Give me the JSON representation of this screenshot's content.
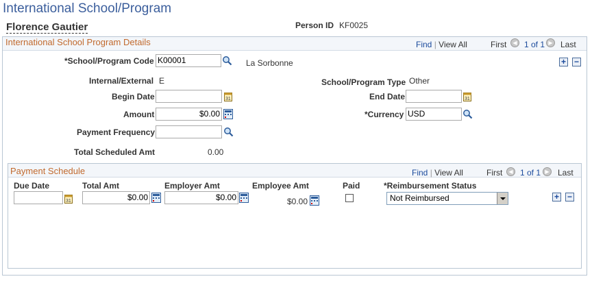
{
  "page": {
    "title": "International School/Program"
  },
  "person": {
    "name": "Florence Gautier",
    "id_label": "Person ID",
    "id_value": "KF0025"
  },
  "details": {
    "title": "International School Program Details",
    "nav": {
      "find": "Find",
      "view_all": "View All",
      "first": "First",
      "counter": "1 of 1",
      "last": "Last"
    },
    "school_code": {
      "label": "*School/Program Code",
      "value": "K00001",
      "description": "La Sorbonne"
    },
    "internal_external": {
      "label": "Internal/External",
      "value": "E"
    },
    "program_type": {
      "label": "School/Program Type",
      "value": "Other"
    },
    "begin_date": {
      "label": "Begin Date",
      "value": ""
    },
    "end_date": {
      "label": "End Date",
      "value": ""
    },
    "amount": {
      "label": "Amount",
      "value": "$0.00"
    },
    "currency": {
      "label": "*Currency",
      "value": "USD"
    },
    "payment_frequency": {
      "label": "Payment Frequency",
      "value": ""
    },
    "total_scheduled": {
      "label": "Total Scheduled Amt",
      "value": "0.00"
    }
  },
  "schedule": {
    "title": "Payment Schedule",
    "nav": {
      "find": "Find",
      "view_all": "View All",
      "first": "First",
      "counter": "1 of 1",
      "last": "Last"
    },
    "columns": {
      "due_date": "Due Date",
      "total_amt": "Total Amt",
      "employer_amt": "Employer Amt",
      "employee_amt": "Employee Amt",
      "paid": "Paid",
      "reimbursement": "*Reimbursement Status"
    },
    "row": {
      "due_date": "",
      "total_amt": "$0.00",
      "employer_amt": "$0.00",
      "employee_amt": "$0.00",
      "paid": false,
      "reimbursement": "Not Reimbursed"
    }
  },
  "icons": {
    "lookup": "magnifier-icon",
    "calendar": "calendar-icon",
    "calculator": "calculator-icon",
    "prev": "arrow-left-icon",
    "next": "arrow-right-icon",
    "add": "add-row-icon",
    "delete": "delete-row-icon"
  }
}
